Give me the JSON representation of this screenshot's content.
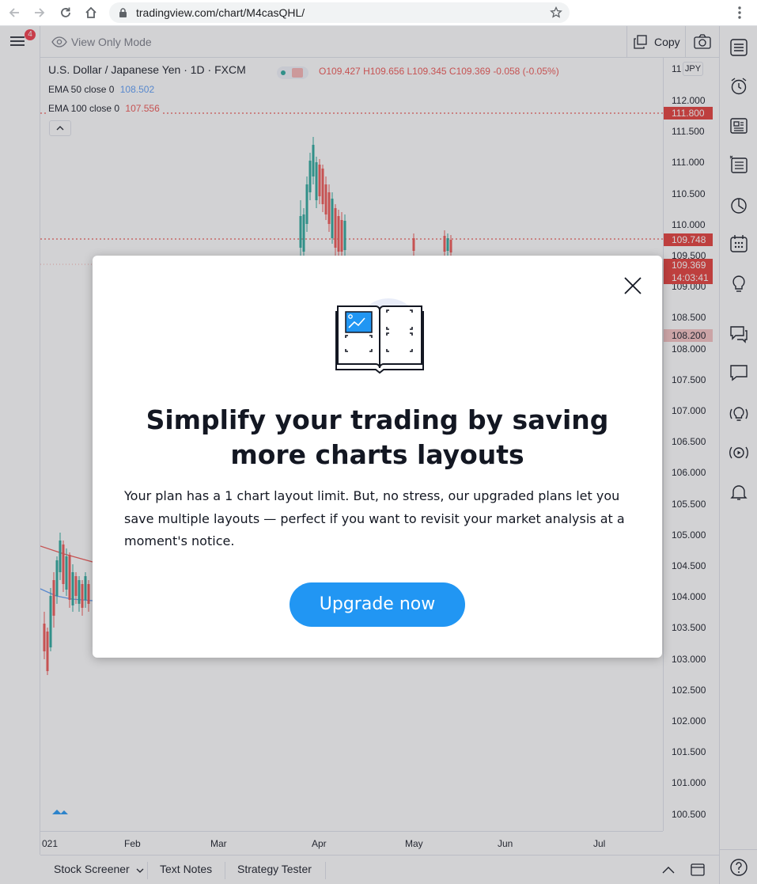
{
  "browser": {
    "url": "tradingview.com/chart/M4casQHL/"
  },
  "app": {
    "menu_badge": "4",
    "view_mode": "View Only Mode",
    "copy_label": "Copy",
    "symbol_title": "U.S. Dollar / Japanese Yen · 1D · FXCM",
    "ohlc": {
      "o_label": "O",
      "o": "109.427",
      "h_label": "H",
      "h": "109.656",
      "l_label": "L",
      "l": "109.345",
      "c_label": "C",
      "c": "109.369",
      "change": "-0.058 (-0.05%)"
    },
    "currency": "JPY",
    "ema50_label": "EMA 50 close 0",
    "ema50_value": "108.502",
    "ema100_label": "EMA 100 close 0",
    "ema100_value": "107.556",
    "price_ticks": [
      "112.000",
      "111.500",
      "111.000",
      "110.500",
      "110.000",
      "109.500",
      "109.000",
      "108.500",
      "108.000",
      "107.500",
      "107.000",
      "106.500",
      "106.000",
      "105.500",
      "105.000",
      "104.500",
      "104.000",
      "103.500",
      "103.000",
      "102.500",
      "102.000",
      "101.500",
      "101.000",
      "100.500"
    ],
    "price_ticks_top_partial": "11",
    "tags": {
      "t1": "111.800",
      "t2": "109.748",
      "t3": "109.369",
      "t3_time": "14:03:41",
      "t4": "108.200"
    },
    "time_ticks": [
      "021",
      "Feb",
      "Mar",
      "Apr",
      "May",
      "Jun",
      "Jul"
    ],
    "bottom_tabs": [
      "Stock Screener",
      "Text Notes",
      "Strategy Tester"
    ],
    "colors": {
      "up": "#26a69a",
      "down": "#ef5350",
      "accent": "#2196f3",
      "tag_red": "#e53935"
    }
  },
  "modal": {
    "title": "Simplify your trading by saving more charts layouts",
    "body": "Your plan has a 1 chart layout limit. But, no stress, our upgraded plans let you save multiple layouts — perfect if you want to revisit your market analysis at a moment's notice.",
    "button": "Upgrade now"
  }
}
